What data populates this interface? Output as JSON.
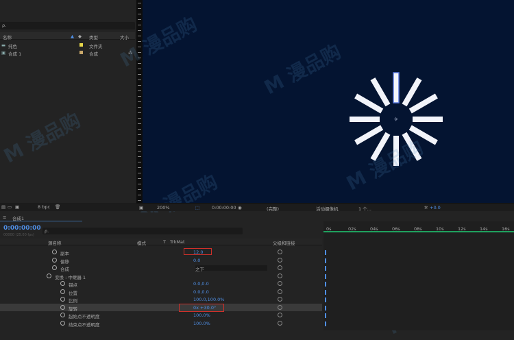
{
  "project": {
    "search_placeholder": "ρ.",
    "columns": {
      "name": "名称",
      "type": "类型",
      "size": "大小"
    },
    "items": [
      {
        "name": "纯色",
        "type": "文件夹",
        "color": "#e8d84a"
      },
      {
        "name": "合成 1",
        "type": "合成",
        "color": "#c9a86a"
      }
    ],
    "bpc": "8 bpc"
  },
  "viewer": {
    "zoom": "200%",
    "timecode": "0:00:00:00",
    "quality": "(完整)",
    "camera": "活动摄像机",
    "views": "1 个...",
    "exposure": "+0.0",
    "spokes": 12,
    "spoke_color": "#f2f4fa",
    "bg": "#041431"
  },
  "timeline": {
    "tab_label": "合成1",
    "timecode": "0:00:00:00",
    "fps_note": "00000 (25.00 fps)",
    "search_placeholder": "ρ.",
    "columns": {
      "source": "源名称",
      "mode": "模式",
      "t": "T",
      "trkmat": "TrkMat",
      "parent": "父级和链接"
    },
    "layers": [
      {
        "indent": 76,
        "name": "副本",
        "value": "12.0"
      },
      {
        "indent": 76,
        "name": "偏移",
        "value": "0.0"
      },
      {
        "indent": 76,
        "name": "合成",
        "value": "",
        "dropdown": "之下"
      },
      {
        "indent": 68,
        "name": "变换 : 中继器 1",
        "value": ""
      },
      {
        "indent": 88,
        "name": "锚点",
        "value": "0.0,0.0"
      },
      {
        "indent": 88,
        "name": "位置",
        "value": "0.0,0.0"
      },
      {
        "indent": 88,
        "name": "比例",
        "value": "100.0,100.0%",
        "link": true
      },
      {
        "indent": 88,
        "name": "旋转",
        "value": "0x +30.0°"
      },
      {
        "indent": 88,
        "name": "起始点不透明度",
        "value": "100.0%"
      },
      {
        "indent": 88,
        "name": "结束点不透明度",
        "value": "100.0%"
      }
    ],
    "ruler": [
      "0s",
      "02s",
      "04s",
      "06s",
      "08s",
      "10s",
      "12s",
      "14s",
      "16s"
    ]
  },
  "watermark": "M 漫品购",
  "accent": "#4f8fe6",
  "highlight": "#d0302a"
}
